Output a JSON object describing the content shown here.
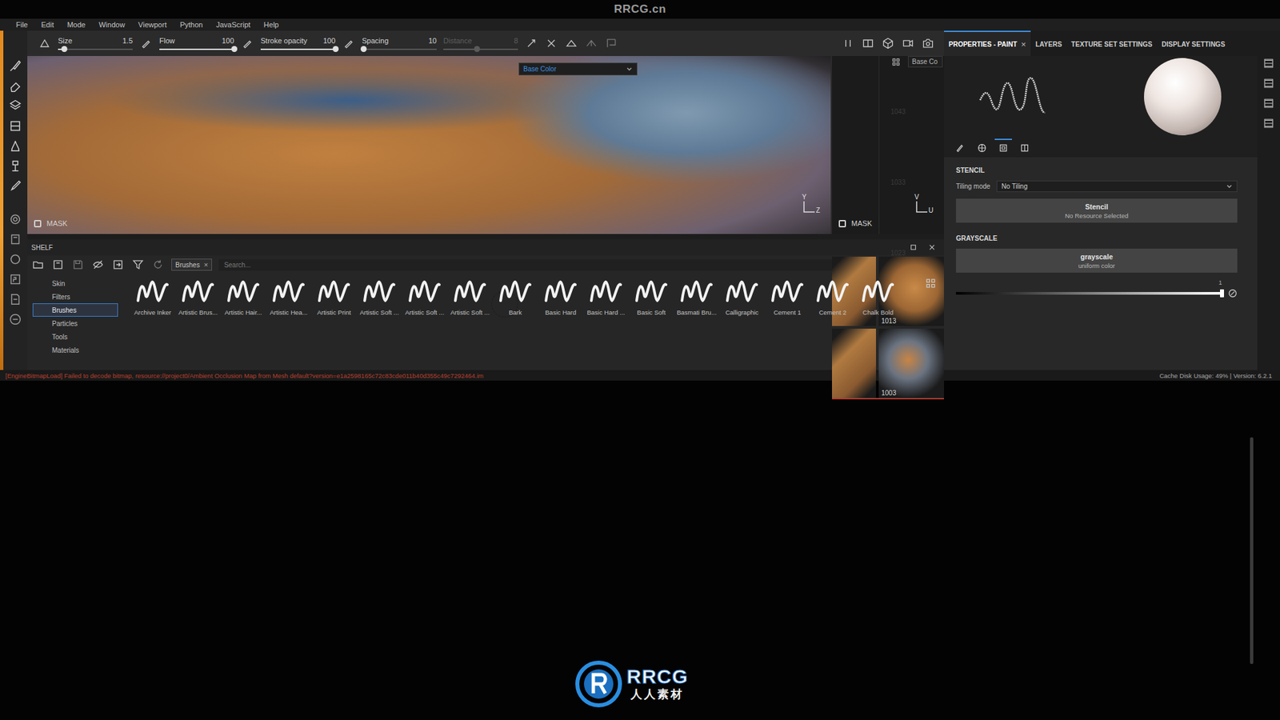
{
  "watermark": {
    "top": "RRCG.cn",
    "logo": "RRCG",
    "logo_sub": "人人素材"
  },
  "menu": [
    "File",
    "Edit",
    "Mode",
    "Window",
    "Viewport",
    "Python",
    "JavaScript",
    "Help"
  ],
  "toolbar": {
    "params": [
      {
        "label": "Size",
        "value": "1.5",
        "level": 0.08,
        "disabled": false
      },
      {
        "label": "Flow",
        "value": "100",
        "level": 1,
        "disabled": false
      },
      {
        "label": "Stroke opacity",
        "value": "100",
        "level": 1,
        "disabled": false
      },
      {
        "label": "Spacing",
        "value": "10",
        "level": 0.02,
        "disabled": false
      },
      {
        "label": "Distance",
        "value": "8",
        "level": 0.45,
        "disabled": true
      }
    ]
  },
  "viewport_3d": {
    "channel": "Base Color",
    "mask": "MASK",
    "axis_up": "Y",
    "axis_side": "Z"
  },
  "viewport_2d": {
    "channel": "Base Co",
    "mask": "MASK",
    "axis_up": "V",
    "axis_side": "U",
    "ruler": [
      "1043",
      "1033",
      "1023"
    ],
    "tiles": [
      "1013",
      "1003"
    ]
  },
  "panel": {
    "close_glyph": "×",
    "tabs": [
      {
        "label": "PROPERTIES - PAINT",
        "selected": true,
        "closable": true
      },
      {
        "label": "LAYERS",
        "selected": false,
        "closable": false
      },
      {
        "label": "TEXTURE SET SETTINGS",
        "selected": false,
        "closable": false
      },
      {
        "label": "DISPLAY SETTINGS",
        "selected": false,
        "closable": false
      }
    ],
    "property_modes": [
      {
        "selected": false
      },
      {
        "selected": false
      },
      {
        "selected": true
      },
      {
        "selected": false
      }
    ],
    "stencil": {
      "heading": "STENCIL",
      "tiling_label": "Tiling mode",
      "tiling_value": "No Tiling",
      "button_title": "Stencil",
      "button_sub": "No Resource Selected"
    },
    "grayscale": {
      "heading": "GRAYSCALE",
      "button_title": "grayscale",
      "button_sub": "uniform color",
      "value": "1",
      "level": 1
    }
  },
  "shelf": {
    "title": "SHELF",
    "chip": "Brushes",
    "chip_close": "×",
    "search_placeholder": "Search...",
    "categories": [
      {
        "label": "Skin",
        "selected": false
      },
      {
        "label": "Filters",
        "selected": false
      },
      {
        "label": "Brushes",
        "selected": true
      },
      {
        "label": "Particles",
        "selected": false
      },
      {
        "label": "Tools",
        "selected": false
      },
      {
        "label": "Materials",
        "selected": false
      }
    ],
    "brushes": [
      "Archive Inker",
      "Artistic Brus...",
      "Artistic Hair...",
      "Artistic Hea...",
      "Artistic Print",
      "Artistic Soft ...",
      "Artistic Soft ...",
      "Artistic Soft ...",
      "Bark",
      "Basic Hard",
      "Basic Hard ...",
      "Basic Soft",
      "Basmati Bru...",
      "Calligraphic",
      "Cement 1",
      "Cement 2",
      "Chalk Bold"
    ]
  },
  "status_bar": {
    "error": "[EngineBitmapLoad] Failed to decode bitmap, resource://project0/Ambient Occlusion Map from Mesh default?version=e1a2598165c72c83cde011b40d355c49c7292464.im",
    "info": "Cache Disk Usage:  49% | Version: 6.2.1"
  }
}
